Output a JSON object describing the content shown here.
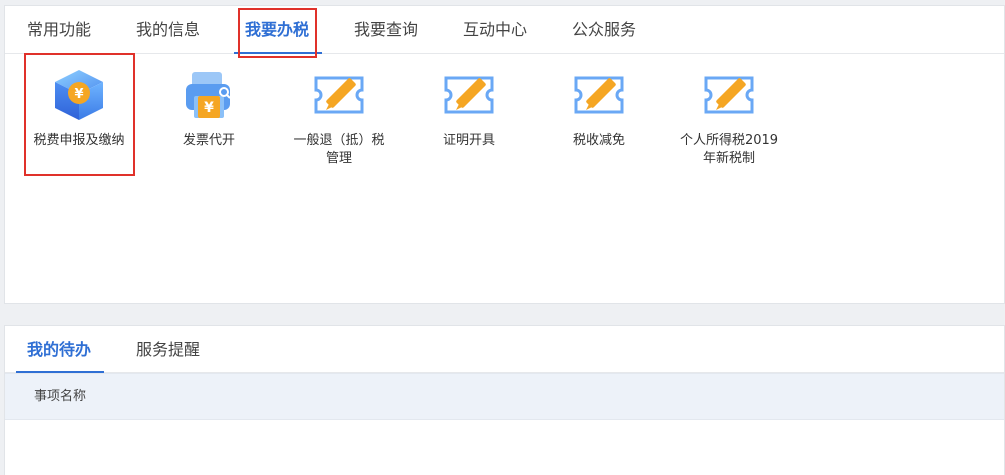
{
  "top_tabs": [
    {
      "label": "常用功能",
      "active": false
    },
    {
      "label": "我的信息",
      "active": false
    },
    {
      "label": "我要办税",
      "active": true
    },
    {
      "label": "我要查询",
      "active": false
    },
    {
      "label": "互动中心",
      "active": false
    },
    {
      "label": "公众服务",
      "active": false
    }
  ],
  "functions": [
    {
      "label": "税费申报及缴纳",
      "icon": "tax-cube-icon"
    },
    {
      "label": "发票代开",
      "icon": "invoice-printer-icon"
    },
    {
      "label": "一般退（抵）税管理",
      "icon": "ticket-pencil-icon"
    },
    {
      "label": "证明开具",
      "icon": "ticket-pencil-icon"
    },
    {
      "label": "税收减免",
      "icon": "ticket-pencil-icon"
    },
    {
      "label": "个人所得税2019年新税制",
      "icon": "ticket-pencil-icon"
    }
  ],
  "bottom_tabs": [
    {
      "label": "我的待办",
      "active": true
    },
    {
      "label": "服务提醒",
      "active": false
    }
  ],
  "table": {
    "headers": [
      "事项名称"
    ]
  },
  "colors": {
    "accent": "#2f6fd4",
    "highlight": "#e0312a",
    "icon_orange": "#f5a623",
    "icon_blue": "#6aa8f5"
  }
}
